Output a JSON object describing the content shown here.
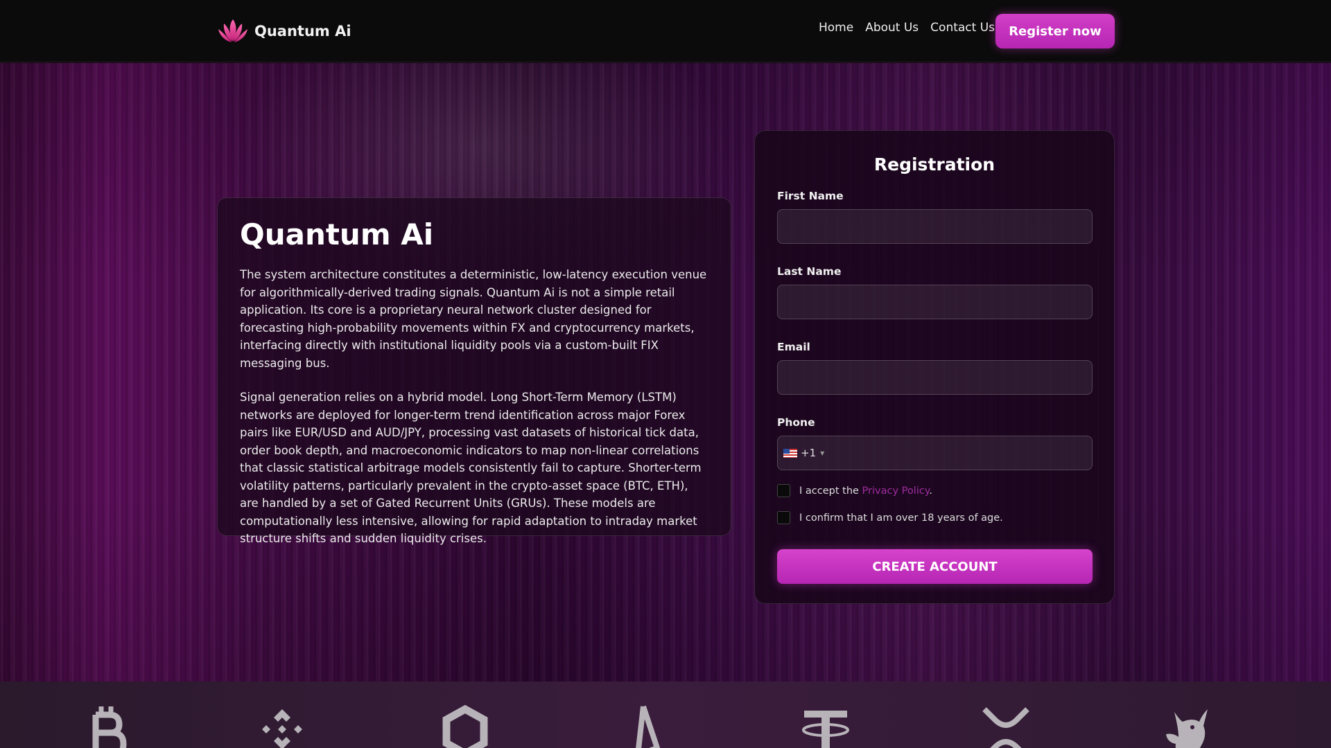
{
  "header": {
    "brand": "Quantum Ai",
    "nav": [
      "Home",
      "About Us",
      "Contact Us"
    ],
    "register_label": "Register now"
  },
  "info": {
    "title": "Quantum Ai",
    "paragraphs": [
      "The system architecture constitutes a deterministic, low-latency execution venue for algorithmically-derived trading signals. Quantum Ai is not a simple retail application. Its core is a proprietary neural network cluster designed for forecasting high-probability movements within FX and cryptocurrency markets, interfacing directly with institutional liquidity pools via a custom-built FIX messaging bus.",
      "Signal generation relies on a hybrid model. Long Short-Term Memory (LSTM) networks are deployed for longer-term trend identification across major Forex pairs like EUR/USD and AUD/JPY, processing vast datasets of historical tick data, order book depth, and macroeconomic indicators to map non-linear correlations that classic statistical arbitrage models consistently fail to capture. Shorter-term volatility patterns, particularly prevalent in the crypto-asset space (BTC, ETH), are handled by a set of Gated Recurrent Units (GRUs). These models are computationally less intensive, allowing for rapid adaptation to intraday market structure shifts and sudden liquidity crises."
    ]
  },
  "form": {
    "title": "Registration",
    "first_name_label": "First Name",
    "last_name_label": "Last Name",
    "email_label": "Email",
    "phone_label": "Phone",
    "dial_code": "+1",
    "privacy_prefix": "I accept the ",
    "privacy_link": "Privacy Policy",
    "privacy_suffix": ".",
    "age_confirm": "I confirm that I am over 18 years of age.",
    "submit_label": "CREATE ACCOUNT"
  },
  "crypto_strip": {
    "icons": [
      "bitcoin-icon",
      "binance-icon",
      "chainlink-icon",
      "tron-icon",
      "tether-icon",
      "xrp-icon",
      "uniswap-icon"
    ],
    "icon_color": "#b7b3b8"
  },
  "colors": {
    "accent": "#c935c0",
    "link": "#a02ca0"
  }
}
